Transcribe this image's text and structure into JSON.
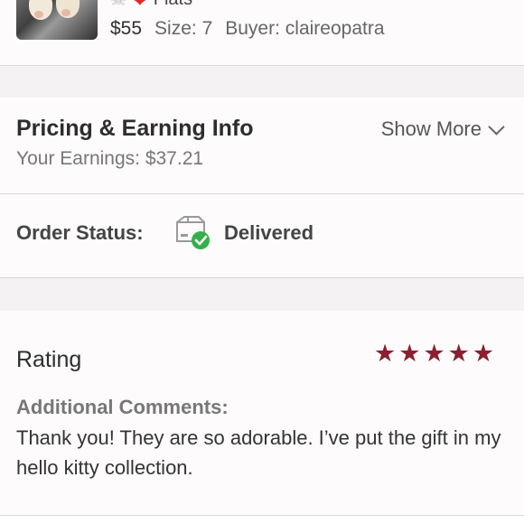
{
  "order_item": {
    "title": "Flats",
    "title_icons": [
      "skull-icon",
      "red-heart-icon"
    ],
    "price": "$55",
    "size": "Size: 7",
    "buyer": "Buyer: claireopatra"
  },
  "pricing": {
    "heading": "Pricing & Earning Info",
    "earnings": "Your Earnings: $37.21",
    "show_more_label": "Show More"
  },
  "order_status": {
    "label": "Order Status:",
    "value": "Delivered",
    "icon": "delivered-package-icon",
    "icon_check_color": "#34b04a"
  },
  "rating": {
    "heading": "Rating",
    "stars": 5,
    "max_stars": 5,
    "star_color": "#8b1f2f",
    "comments_label": "Additional Comments:",
    "comments_text": "Thank you! They are so adorable. I’ve put the gift in my hello kitty collection."
  }
}
